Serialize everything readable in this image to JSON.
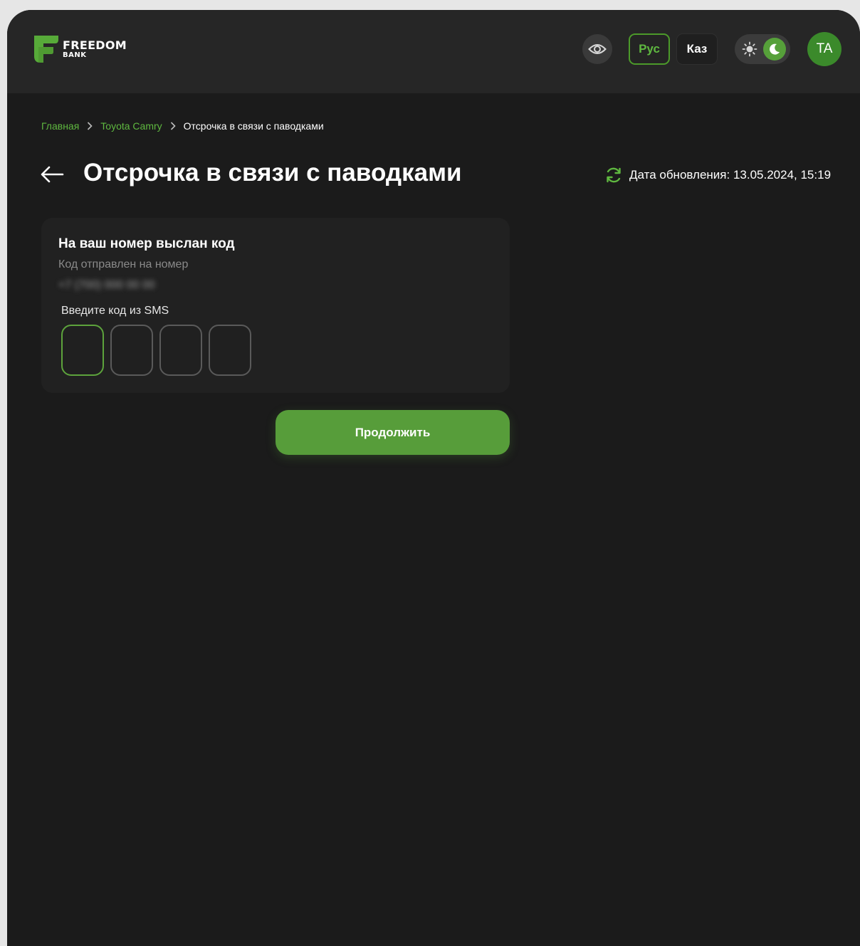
{
  "brand": {
    "name_line1": "FREEDOM",
    "name_line2": "BANK",
    "accent_color": "#579d3a"
  },
  "header": {
    "eye_icon": "eye-icon",
    "languages": [
      {
        "label": "Рус",
        "selected": true
      },
      {
        "label": "Каз",
        "selected": false
      }
    ],
    "theme_toggle": {
      "sun_icon": "sun-icon",
      "moon_icon": "moon-icon",
      "mode": "dark"
    },
    "avatar_initials": "TA"
  },
  "breadcrumb": {
    "items": [
      "Главная",
      "Toyota Camry",
      "Отсрочка в связи с паводками"
    ],
    "separator_icon": "chevron-right-icon"
  },
  "page": {
    "back_icon": "arrow-left-icon",
    "title": "Отсрочка в связи с паводками",
    "update_label": "Дата обновления: 13.05.2024, 15:19",
    "refresh_icon": "refresh-icon"
  },
  "sms_card": {
    "title": "На ваш номер выслан код",
    "subtitle": "Код отправлен на номер",
    "phone_masked": "+7 (700) 000 00 00",
    "input_label": "Введите код из SMS",
    "code_digits": [
      "",
      "",
      "",
      ""
    ]
  },
  "actions": {
    "continue_label": "Продолжить"
  }
}
